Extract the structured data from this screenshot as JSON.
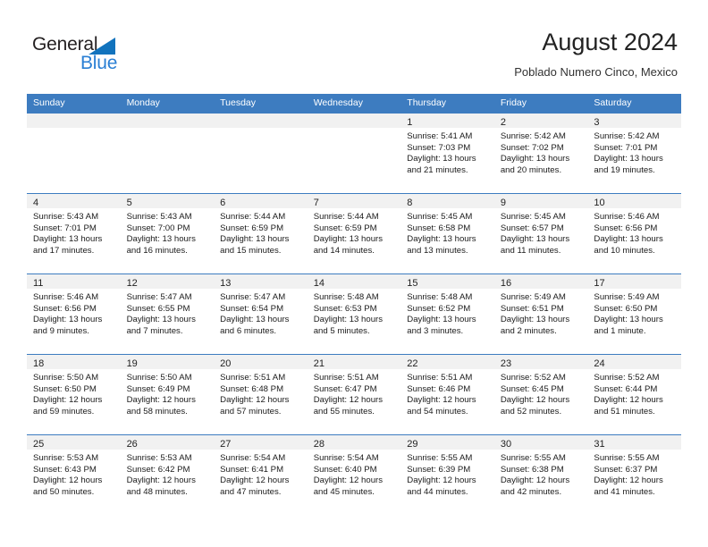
{
  "brand": {
    "name_part1": "General",
    "name_part2": "Blue",
    "triangle_color": "#1273bd",
    "blue_text_color": "#2a7fd4"
  },
  "header": {
    "title": "August 2024",
    "location": "Poblado Numero Cinco, Mexico",
    "accent_color": "#3d7cc0"
  },
  "weekdays": [
    "Sunday",
    "Monday",
    "Tuesday",
    "Wednesday",
    "Thursday",
    "Friday",
    "Saturday"
  ],
  "weeks": [
    [
      {
        "day": "",
        "lines": []
      },
      {
        "day": "",
        "lines": []
      },
      {
        "day": "",
        "lines": []
      },
      {
        "day": "",
        "lines": []
      },
      {
        "day": "1",
        "lines": [
          "Sunrise: 5:41 AM",
          "Sunset: 7:03 PM",
          "Daylight: 13 hours",
          "and 21 minutes."
        ]
      },
      {
        "day": "2",
        "lines": [
          "Sunrise: 5:42 AM",
          "Sunset: 7:02 PM",
          "Daylight: 13 hours",
          "and 20 minutes."
        ]
      },
      {
        "day": "3",
        "lines": [
          "Sunrise: 5:42 AM",
          "Sunset: 7:01 PM",
          "Daylight: 13 hours",
          "and 19 minutes."
        ]
      }
    ],
    [
      {
        "day": "4",
        "lines": [
          "Sunrise: 5:43 AM",
          "Sunset: 7:01 PM",
          "Daylight: 13 hours",
          "and 17 minutes."
        ]
      },
      {
        "day": "5",
        "lines": [
          "Sunrise: 5:43 AM",
          "Sunset: 7:00 PM",
          "Daylight: 13 hours",
          "and 16 minutes."
        ]
      },
      {
        "day": "6",
        "lines": [
          "Sunrise: 5:44 AM",
          "Sunset: 6:59 PM",
          "Daylight: 13 hours",
          "and 15 minutes."
        ]
      },
      {
        "day": "7",
        "lines": [
          "Sunrise: 5:44 AM",
          "Sunset: 6:59 PM",
          "Daylight: 13 hours",
          "and 14 minutes."
        ]
      },
      {
        "day": "8",
        "lines": [
          "Sunrise: 5:45 AM",
          "Sunset: 6:58 PM",
          "Daylight: 13 hours",
          "and 13 minutes."
        ]
      },
      {
        "day": "9",
        "lines": [
          "Sunrise: 5:45 AM",
          "Sunset: 6:57 PM",
          "Daylight: 13 hours",
          "and 11 minutes."
        ]
      },
      {
        "day": "10",
        "lines": [
          "Sunrise: 5:46 AM",
          "Sunset: 6:56 PM",
          "Daylight: 13 hours",
          "and 10 minutes."
        ]
      }
    ],
    [
      {
        "day": "11",
        "lines": [
          "Sunrise: 5:46 AM",
          "Sunset: 6:56 PM",
          "Daylight: 13 hours",
          "and 9 minutes."
        ]
      },
      {
        "day": "12",
        "lines": [
          "Sunrise: 5:47 AM",
          "Sunset: 6:55 PM",
          "Daylight: 13 hours",
          "and 7 minutes."
        ]
      },
      {
        "day": "13",
        "lines": [
          "Sunrise: 5:47 AM",
          "Sunset: 6:54 PM",
          "Daylight: 13 hours",
          "and 6 minutes."
        ]
      },
      {
        "day": "14",
        "lines": [
          "Sunrise: 5:48 AM",
          "Sunset: 6:53 PM",
          "Daylight: 13 hours",
          "and 5 minutes."
        ]
      },
      {
        "day": "15",
        "lines": [
          "Sunrise: 5:48 AM",
          "Sunset: 6:52 PM",
          "Daylight: 13 hours",
          "and 3 minutes."
        ]
      },
      {
        "day": "16",
        "lines": [
          "Sunrise: 5:49 AM",
          "Sunset: 6:51 PM",
          "Daylight: 13 hours",
          "and 2 minutes."
        ]
      },
      {
        "day": "17",
        "lines": [
          "Sunrise: 5:49 AM",
          "Sunset: 6:50 PM",
          "Daylight: 13 hours",
          "and 1 minute."
        ]
      }
    ],
    [
      {
        "day": "18",
        "lines": [
          "Sunrise: 5:50 AM",
          "Sunset: 6:50 PM",
          "Daylight: 12 hours",
          "and 59 minutes."
        ]
      },
      {
        "day": "19",
        "lines": [
          "Sunrise: 5:50 AM",
          "Sunset: 6:49 PM",
          "Daylight: 12 hours",
          "and 58 minutes."
        ]
      },
      {
        "day": "20",
        "lines": [
          "Sunrise: 5:51 AM",
          "Sunset: 6:48 PM",
          "Daylight: 12 hours",
          "and 57 minutes."
        ]
      },
      {
        "day": "21",
        "lines": [
          "Sunrise: 5:51 AM",
          "Sunset: 6:47 PM",
          "Daylight: 12 hours",
          "and 55 minutes."
        ]
      },
      {
        "day": "22",
        "lines": [
          "Sunrise: 5:51 AM",
          "Sunset: 6:46 PM",
          "Daylight: 12 hours",
          "and 54 minutes."
        ]
      },
      {
        "day": "23",
        "lines": [
          "Sunrise: 5:52 AM",
          "Sunset: 6:45 PM",
          "Daylight: 12 hours",
          "and 52 minutes."
        ]
      },
      {
        "day": "24",
        "lines": [
          "Sunrise: 5:52 AM",
          "Sunset: 6:44 PM",
          "Daylight: 12 hours",
          "and 51 minutes."
        ]
      }
    ],
    [
      {
        "day": "25",
        "lines": [
          "Sunrise: 5:53 AM",
          "Sunset: 6:43 PM",
          "Daylight: 12 hours",
          "and 50 minutes."
        ]
      },
      {
        "day": "26",
        "lines": [
          "Sunrise: 5:53 AM",
          "Sunset: 6:42 PM",
          "Daylight: 12 hours",
          "and 48 minutes."
        ]
      },
      {
        "day": "27",
        "lines": [
          "Sunrise: 5:54 AM",
          "Sunset: 6:41 PM",
          "Daylight: 12 hours",
          "and 47 minutes."
        ]
      },
      {
        "day": "28",
        "lines": [
          "Sunrise: 5:54 AM",
          "Sunset: 6:40 PM",
          "Daylight: 12 hours",
          "and 45 minutes."
        ]
      },
      {
        "day": "29",
        "lines": [
          "Sunrise: 5:55 AM",
          "Sunset: 6:39 PM",
          "Daylight: 12 hours",
          "and 44 minutes."
        ]
      },
      {
        "day": "30",
        "lines": [
          "Sunrise: 5:55 AM",
          "Sunset: 6:38 PM",
          "Daylight: 12 hours",
          "and 42 minutes."
        ]
      },
      {
        "day": "31",
        "lines": [
          "Sunrise: 5:55 AM",
          "Sunset: 6:37 PM",
          "Daylight: 12 hours",
          "and 41 minutes."
        ]
      }
    ]
  ]
}
